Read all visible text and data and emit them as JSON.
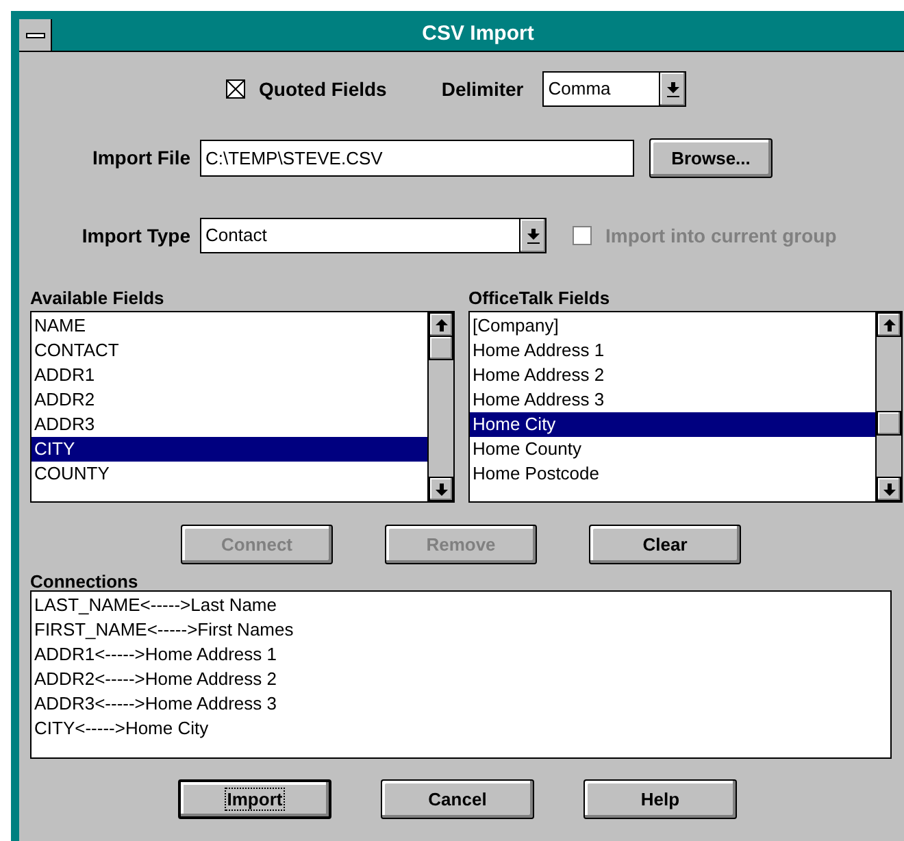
{
  "window": {
    "title": "CSV Import"
  },
  "quoted_fields": {
    "label": "Quoted Fields",
    "checked": true,
    "disabled": false
  },
  "delimiter": {
    "label": "Delimiter",
    "value": "Comma"
  },
  "import_file": {
    "label": "Import File",
    "value": "C:\\TEMP\\STEVE.CSV"
  },
  "browse_button": {
    "label": "Browse...",
    "disabled": false,
    "default": false
  },
  "import_type": {
    "label": "Import Type",
    "value": "Contact"
  },
  "import_into_group": {
    "label": "Import into current group",
    "checked": false,
    "disabled": true
  },
  "available_fields": {
    "label": "Available Fields",
    "items": [
      {
        "text": "NAME",
        "selected": false
      },
      {
        "text": "CONTACT",
        "selected": false
      },
      {
        "text": "ADDR1",
        "selected": false
      },
      {
        "text": "ADDR2",
        "selected": false
      },
      {
        "text": "ADDR3",
        "selected": false
      },
      {
        "text": "CITY",
        "selected": true
      },
      {
        "text": "COUNTY",
        "selected": false
      }
    ]
  },
  "officetalk_fields": {
    "label": "OfficeTalk Fields",
    "items": [
      {
        "text": "[Company]",
        "selected": false
      },
      {
        "text": "Home Address 1",
        "selected": false
      },
      {
        "text": "Home Address 2",
        "selected": false
      },
      {
        "text": "Home Address 3",
        "selected": false
      },
      {
        "text": "Home City",
        "selected": true
      },
      {
        "text": "Home County",
        "selected": false
      },
      {
        "text": "Home Postcode",
        "selected": false
      }
    ]
  },
  "middle_buttons": [
    {
      "label": "Connect",
      "disabled": true,
      "default": false
    },
    {
      "label": "Remove",
      "disabled": true,
      "default": false
    },
    {
      "label": "Clear",
      "disabled": false,
      "default": false
    }
  ],
  "connections": {
    "label": "Connections",
    "items": [
      "LAST_NAME<----->Last Name",
      "FIRST_NAME<----->First Names",
      "ADDR1<----->Home Address 1",
      "ADDR2<----->Home Address 2",
      "ADDR3<----->Home Address 3",
      "CITY<----->Home City"
    ]
  },
  "bottom_buttons": [
    {
      "label": "Import",
      "disabled": false,
      "default": true
    },
    {
      "label": "Cancel",
      "disabled": false,
      "default": false
    },
    {
      "label": "Help",
      "disabled": false,
      "default": false
    }
  ]
}
